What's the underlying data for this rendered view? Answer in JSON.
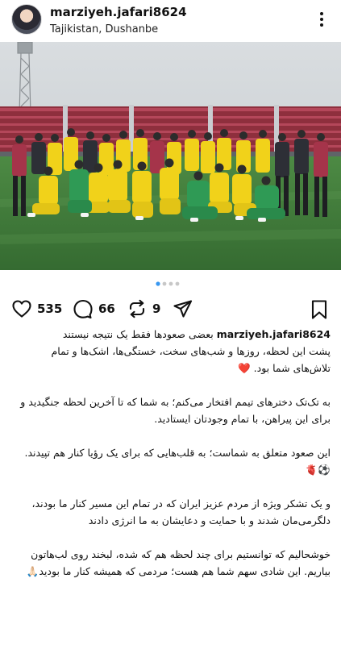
{
  "post": {
    "username": "marziyeh.jafari8624",
    "location": "Tajikistan, Dushanbe",
    "likes": "535",
    "comments": "66",
    "shares": "9"
  },
  "caption": {
    "username": "marziyeh.jafari8624",
    "line1": "بعضی صعودها فقط یک نتیجه نیستند",
    "p1": "پشت این لحظه، روزها و شب‌های سخت، خستگی‌ها، اشک‌ها و تمام تلاش‌های شما بود. ❤️",
    "p2": "به تک‌تک دخترهای تیمم افتخار می‌کنم؛ به شما که تا آخرین لحظه جنگیدید و برای این پیراهن، با تمام وجودتان ایستادید.",
    "p3": "این صعود متعلق به شماست؛ به قلب‌هایی که برای یک رؤیا کنار هم تپیدند. ⚽️🫀",
    "p4": "و یک تشکر ویژه از مردم عزیز ایران که در تمام این مسیر کنار ما بودند، دلگرمی‌مان شدند و با حمایت و دعایشان به ما انرژی دادند",
    "p5": "خوشحالیم که توانستیم برای چند لحظه هم که شده، لبخند روی لب‌هاتون بیاریم. این شادی سهم شما هم هست؛ مردمی که همیشه کنار ما بودید🙏🏻"
  },
  "carousel": {
    "count": 4,
    "active": 0
  },
  "colors": {
    "kit": "#f1d21a",
    "keeper": "#2f9a55",
    "pitch": "#3f7a3a",
    "stands": "#a93a48"
  }
}
